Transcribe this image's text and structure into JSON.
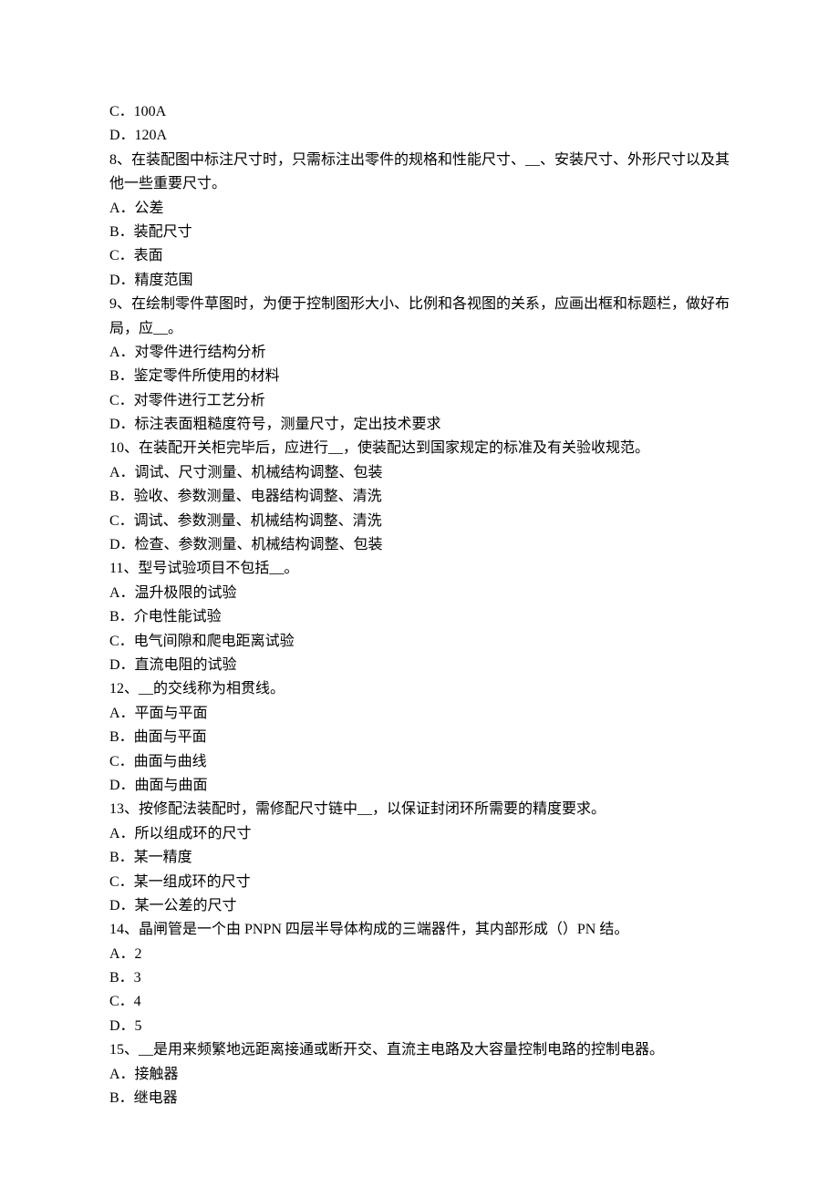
{
  "lines": [
    "C．100A",
    "D．120A",
    "8、在装配图中标注尺寸时，只需标注出零件的规格和性能尺寸、__、安装尺寸、外形尺寸以及其他一些重要尺寸。",
    "A．公差",
    "B．装配尺寸",
    "C．表面",
    "D．精度范围",
    "9、在绘制零件草图时，为便于控制图形大小、比例和各视图的关系，应画出框和标题栏，做好布局，应__。",
    "A．对零件进行结构分析",
    "B．鉴定零件所使用的材料",
    "C．对零件进行工艺分析",
    "D．标注表面粗糙度符号，测量尺寸，定出技术要求",
    "10、在装配开关柜完毕后，应进行__，使装配达到国家规定的标准及有关验收规范。",
    "A．调试、尺寸测量、机械结构调整、包装",
    "B．验收、参数测量、电器结构调整、清洗",
    "C．调试、参数测量、机械结构调整、清洗",
    "D．检查、参数测量、机械结构调整、包装",
    "11、型号试验项目不包括__。",
    "A．温升极限的试验",
    "B．介电性能试验",
    "C．电气间隙和爬电距离试验",
    "D．直流电阻的试验",
    "12、__的交线称为相贯线。",
    "A．平面与平面",
    "B．曲面与平面",
    "C．曲面与曲线",
    "D．曲面与曲面",
    "13、按修配法装配时，需修配尺寸链中__，以保证封闭环所需要的精度要求。",
    "A．所以组成环的尺寸",
    "B．某一精度",
    "C．某一组成环的尺寸",
    "D．某一公差的尺寸",
    "14、晶闸管是一个由 PNPN 四层半导体构成的三端器件，其内部形成（）PN 结。",
    "A．2",
    "B．3",
    "C．4",
    "D．5",
    "15、__是用来频繁地远距离接通或断开交、直流主电路及大容量控制电路的控制电器。",
    "A．接触器",
    "B．继电器"
  ]
}
